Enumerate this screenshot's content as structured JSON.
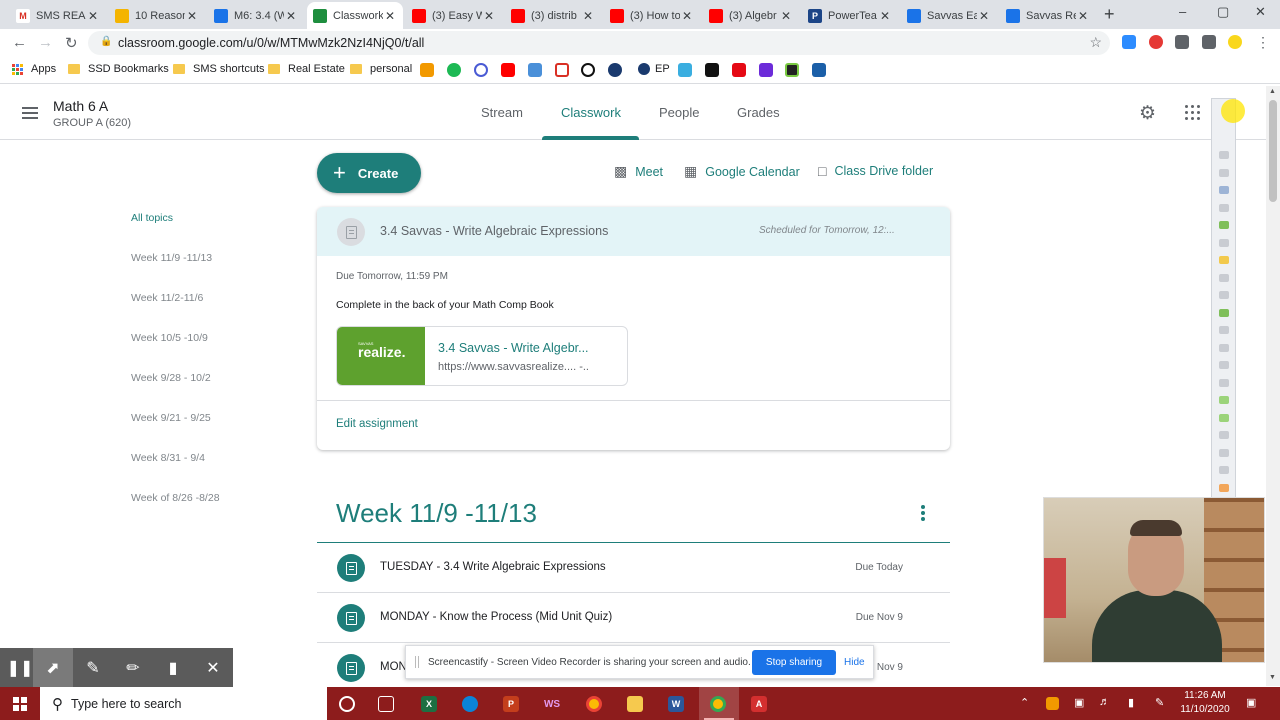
{
  "browser": {
    "tabs": [
      {
        "title": "SMS READ",
        "color": "#ffffff",
        "glyph": "M",
        "gcolor": "#d93025"
      },
      {
        "title": "10 Reason",
        "color": "#f4b400",
        "glyph": "",
        "gcolor": "#fff"
      },
      {
        "title": "M6: 3.4 (W",
        "color": "#1a73e8",
        "glyph": "",
        "gcolor": "#fff"
      },
      {
        "title": "Classwork",
        "color": "#1e8e3e",
        "glyph": "",
        "gcolor": "#fff"
      },
      {
        "title": "(3) Easy W",
        "color": "#ff0000",
        "glyph": "",
        "gcolor": "#fff"
      },
      {
        "title": "(3) distrib",
        "color": "#ff0000",
        "glyph": "",
        "gcolor": "#fff"
      },
      {
        "title": "(3) How to",
        "color": "#ff0000",
        "glyph": "",
        "gcolor": "#fff"
      },
      {
        "title": "(3) Algebr",
        "color": "#ff0000",
        "glyph": "",
        "gcolor": "#fff"
      },
      {
        "title": "PowerTea",
        "color": "#1c4587",
        "glyph": "P",
        "gcolor": "#fff"
      },
      {
        "title": "Savvas Ea",
        "color": "#1a73e8",
        "glyph": "",
        "gcolor": "#fff"
      },
      {
        "title": "Savvas Re",
        "color": "#1a73e8",
        "glyph": "",
        "gcolor": "#fff"
      }
    ],
    "active_tab_index": 3,
    "new_tab": "+",
    "url": "classroom.google.com/u/0/w/MTMwMzk2NzI4NjQ0/t/all"
  },
  "bookmarks": {
    "apps": "Apps",
    "folders": [
      "SSD Bookmarks",
      "SMS shortcuts",
      "Real Estate",
      "personal"
    ],
    "ep_label": "EP"
  },
  "classroom": {
    "class_name": "Math 6 A",
    "class_section": "GROUP A (620)",
    "nav": [
      "Stream",
      "Classwork",
      "People",
      "Grades"
    ],
    "active_nav": "Classwork"
  },
  "topics": [
    "All topics",
    "Week 11/9 -11/13",
    "Week 11/2-11/6",
    "Week 10/5 -10/9",
    "Week 9/28 - 10/2",
    "Week 9/21 - 9/25",
    "Week 8/31 - 9/4",
    "Week of 8/26 -8/28"
  ],
  "actions": {
    "create": "Create",
    "meet": "Meet",
    "calendar": "Google Calendar",
    "drive": "Class Drive folder"
  },
  "assignment_card": {
    "title": "3.4 Savvas - Write Algebraic Expressions",
    "scheduled": "Scheduled for Tomorrow, 12:...",
    "due": "Due Tomorrow, 11:59 PM",
    "description": "Complete in the back of your Math Comp Book",
    "attachment_name": "3.4 Savvas - Write Algebr...",
    "attachment_url": "https://www.savvasrealize....   -..",
    "thumb_brand": "realize.",
    "thumb_small": "SAVVAS",
    "edit": "Edit assignment"
  },
  "week_section": {
    "title": "Week 11/9 -11/13",
    "rows": [
      {
        "title": "TUESDAY - 3.4 Write Algebraic Expressions",
        "due": "Due Today"
      },
      {
        "title": "MONDAY - Know the Process (Mid Unit Quiz)",
        "due": "Due Nov 9"
      },
      {
        "title": "MON",
        "due": "Nov 9"
      }
    ]
  },
  "screencastify": {
    "banner_text": "Screencastify - Screen Video Recorder is sharing your screen and audio.",
    "stop": "Stop sharing",
    "hide": "Hide"
  },
  "taskbar": {
    "search_placeholder": "Type here to search",
    "time": "11:26 AM",
    "date": "11/10/2020"
  }
}
